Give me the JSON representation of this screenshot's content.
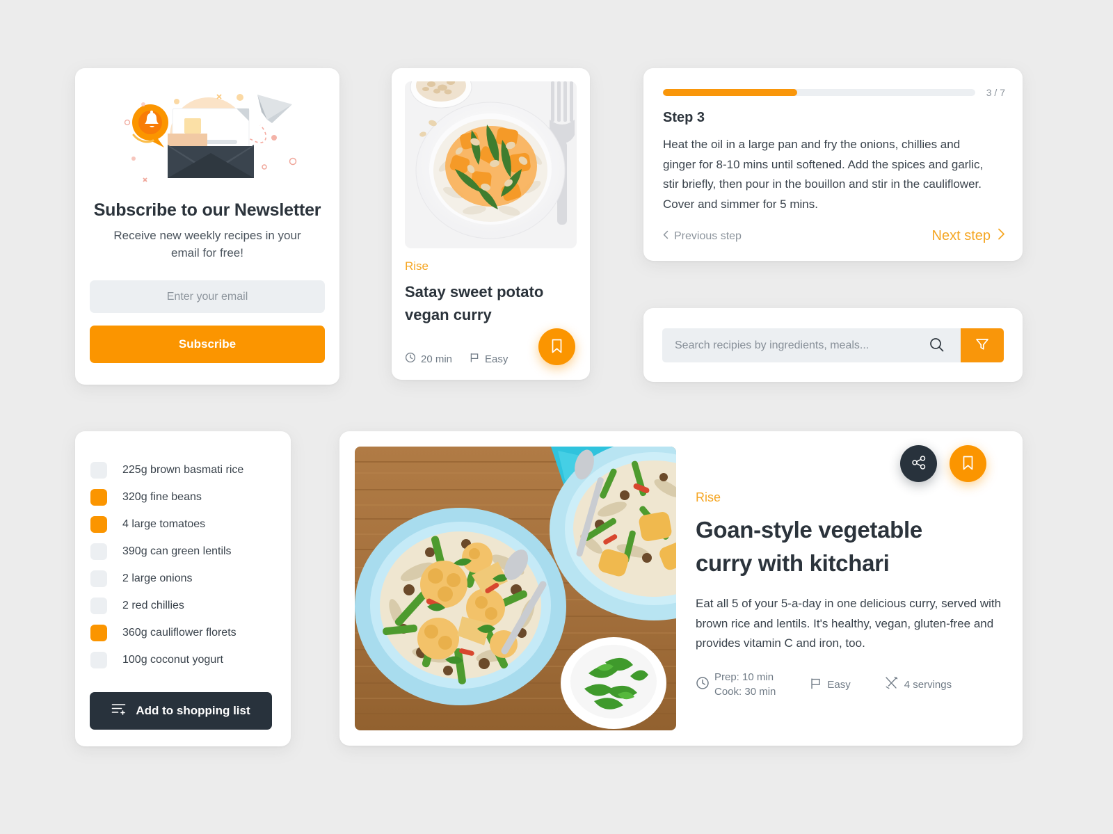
{
  "theme": {
    "accent": "#fb9500",
    "accent_text": "#f5a623",
    "dark": "#28323c",
    "page_bg": "#ececec",
    "muted": "#707b86"
  },
  "newsletter": {
    "title": "Subscribe to our Newsletter",
    "subtitle": "Receive new weekly recipes in your email for free!",
    "email_placeholder": "Enter your email",
    "email_value": "",
    "submit_label": "Subscribe",
    "illustration": "newsletter-envelope-illustration"
  },
  "satay_card": {
    "brand": "Rise",
    "title": "Satay sweet potato vegan curry",
    "time": "20 min",
    "difficulty": "Easy",
    "time_icon": "clock-icon",
    "difficulty_icon": "flag-icon",
    "bookmark_icon": "bookmark-icon",
    "image": "satay-sweet-potato-curry-photo"
  },
  "step_card": {
    "progress_count": "3 / 7",
    "progress_percent": 43,
    "step_title": "Step 3",
    "step_text": "Heat the oil in a large pan and fry the onions, chillies and ginger for 8-10 mins until softened. Add the spices and garlic, stir briefly, then pour in the bouillon and stir in the cauliflower. Cover and simmer for 5 mins.",
    "previous_label": "Previous step",
    "next_label": "Next step",
    "previous_icon": "chevron-left-icon",
    "next_icon": "chevron-right-icon"
  },
  "search": {
    "placeholder": "Search recipies by ingredients, meals...",
    "value": "",
    "search_icon": "search-icon",
    "filter_icon": "filter-funnel-icon"
  },
  "ingredients": {
    "items": [
      {
        "label": "225g brown basmati rice",
        "checked": false
      },
      {
        "label": "320g fine beans",
        "checked": true
      },
      {
        "label": "4 large tomatoes",
        "checked": true
      },
      {
        "label": "390g can green lentils",
        "checked": false
      },
      {
        "label": "2 large onions",
        "checked": false
      },
      {
        "label": "2 red chillies",
        "checked": false
      },
      {
        "label": "360g cauliflower florets",
        "checked": true
      },
      {
        "label": "100g coconut yogurt",
        "checked": false
      }
    ],
    "button_label": "Add to shopping list",
    "button_icon": "add-to-list-icon"
  },
  "goan_card": {
    "brand": "Rise",
    "title": "Goan-style vegetable curry with kitchari",
    "description": "Eat all 5 of your 5-a-day in one delicious curry, served with brown rice and lentils. It's healthy, vegan, gluten-free and provides vitamin C and iron, too.",
    "prep": "Prep: 10 min",
    "cook": "Cook: 30 min",
    "difficulty": "Easy",
    "servings": "4 servings",
    "time_icon": "clock-icon",
    "difficulty_icon": "flag-icon",
    "servings_icon": "cutlery-icon",
    "share_icon": "share-icon",
    "bookmark_icon": "bookmark-icon",
    "image": "goan-vegetable-curry-photo"
  }
}
